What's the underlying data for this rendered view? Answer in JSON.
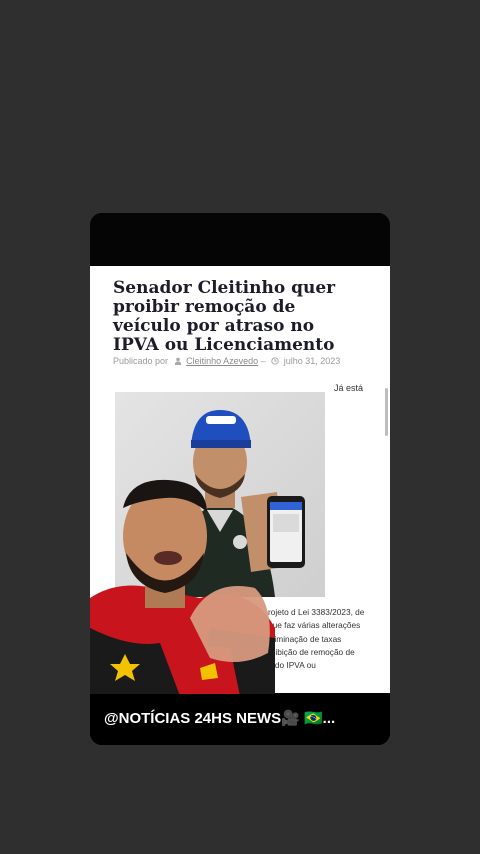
{
  "article": {
    "title": "Senador Cleitinho quer proibir remoção de veículo por atraso no IPVA ou Licenciamento",
    "published_by": "Publicado por",
    "author": "Cleitinho Azevedo",
    "separator": "–",
    "date": "julho 31, 2023",
    "side_text": "Já está",
    "body_lines": [
      "rojeto d Lei 3383/2023, de",
      "que faz várias alterações",
      "eliminação de taxas",
      "roibição de remoção de",
      "o do IPVA ou"
    ]
  },
  "overlay": {
    "caption": "@NOTÍCIAS  24HS NEWS🎥 🇧🇷..."
  },
  "icons": {
    "author": "user-icon",
    "date": "clock-icon",
    "phone": "smartphone-icon"
  },
  "colors": {
    "background": "#2f2f2f",
    "title": "#1c1c2a",
    "cap": "#1f4fbf",
    "jersey_red": "#c8141d"
  }
}
